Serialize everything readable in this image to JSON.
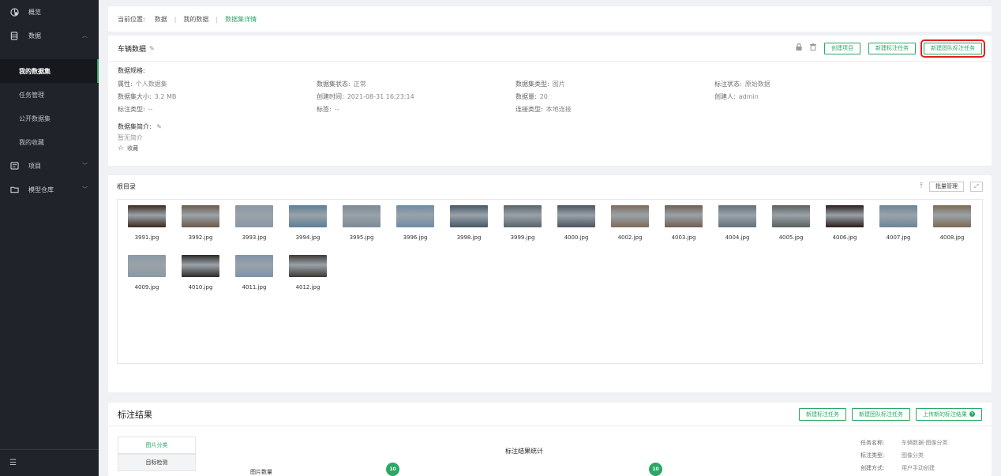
{
  "sidebar": {
    "items": [
      {
        "label": "概览"
      },
      {
        "label": "数据"
      },
      {
        "label": "项目"
      },
      {
        "label": "模型仓库"
      }
    ],
    "sub_items": [
      {
        "label": "我的数据集"
      },
      {
        "label": "任务管理"
      },
      {
        "label": "公开数据集"
      },
      {
        "label": "我的收藏"
      }
    ],
    "bottom_icon": "menu-icon"
  },
  "breadcrumb": {
    "prefix": "当前位置:",
    "items": [
      "数据",
      "我的数据",
      "数据集详情"
    ],
    "separator": "|"
  },
  "dataset": {
    "title": "车辆数据",
    "buttons": {
      "create_project": "创建项目",
      "new_label_task": "新建标注任务",
      "new_team_task": "新建团队标注任务"
    },
    "spec_label": "数据规格:",
    "fields": [
      {
        "k": "属性:",
        "v": "个人数据集"
      },
      {
        "k": "数据集状态:",
        "v": "正常"
      },
      {
        "k": "数据集类型:",
        "v": "图片"
      },
      {
        "k": "标注状态:",
        "v": "原始数据"
      },
      {
        "k": "数据集大小:",
        "v": "3.2 MB"
      },
      {
        "k": "创建时间:",
        "v": "2021-08-31 16:23:14"
      },
      {
        "k": "数据量:",
        "v": "20"
      },
      {
        "k": "创建人:",
        "v": "admin"
      },
      {
        "k": "标注类型:",
        "v": "--"
      },
      {
        "k": "标签:",
        "v": "--"
      },
      {
        "k": "连接类型:",
        "v": "本地连接"
      },
      {
        "k": "",
        "v": ""
      }
    ],
    "desc_label": "数据集简介:",
    "desc_value": "暂无简介",
    "favorite_label": "收藏"
  },
  "files": {
    "title": "根目录",
    "batch_button": "批量管理",
    "items": [
      {
        "name": "3991.jpg",
        "color": "#3a2a1e"
      },
      {
        "name": "3992.jpg",
        "color": "#6b5a4c"
      },
      {
        "name": "3993.jpg",
        "color": "#8a97a8"
      },
      {
        "name": "3994.jpg",
        "color": "#5d7f97"
      },
      {
        "name": "3995.jpg",
        "color": "#7c8a96"
      },
      {
        "name": "3996.jpg",
        "color": "#6f8ba8"
      },
      {
        "name": "3998.jpg",
        "color": "#465866"
      },
      {
        "name": "3999.jpg",
        "color": "#59656a"
      },
      {
        "name": "4000.jpg",
        "color": "#4b5460"
      },
      {
        "name": "4002.jpg",
        "color": "#7d6b5b"
      },
      {
        "name": "4003.jpg",
        "color": "#705f52"
      },
      {
        "name": "4004.jpg",
        "color": "#62717c"
      },
      {
        "name": "4005.jpg",
        "color": "#5a605e"
      },
      {
        "name": "4006.jpg",
        "color": "#2a1d1c"
      },
      {
        "name": "4007.jpg",
        "color": "#6d8597"
      },
      {
        "name": "4008.jpg",
        "color": "#7e6a52"
      },
      {
        "name": "4009.jpg",
        "color": "#8a9aa4"
      },
      {
        "name": "4010.jpg",
        "color": "#2d2a28"
      },
      {
        "name": "4011.jpg",
        "color": "#7d94ab"
      },
      {
        "name": "4012.jpg",
        "color": "#3d3a35"
      }
    ]
  },
  "result": {
    "title": "标注结果",
    "buttons": {
      "new_label_task": "新建标注任务",
      "new_team_task": "新建团队标注任务",
      "upload": "上传新的标注结果"
    },
    "tabs": [
      "图片分类",
      "目标检测"
    ],
    "stat_title": "标注结果统计",
    "stat_label": "图片数量",
    "bubble1": "10",
    "bubble2": "10",
    "meta": [
      {
        "k": "任务名称:",
        "v": "车辆数据-图像分类"
      },
      {
        "k": "标注类型:",
        "v": "图像分类"
      },
      {
        "k": "创建方式:",
        "v": "用户手动创建"
      }
    ]
  },
  "colors": {
    "accent": "#2aa866",
    "highlight": "#e02020",
    "sidebar": "#20232a"
  }
}
